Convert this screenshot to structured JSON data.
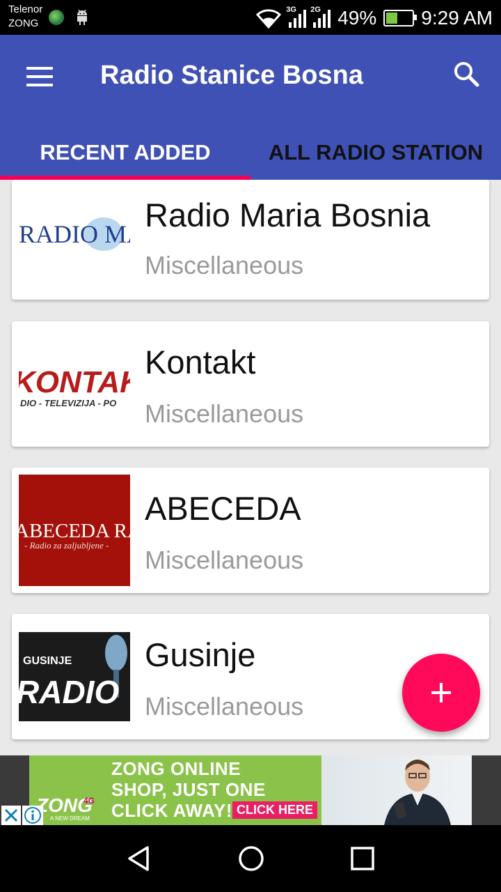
{
  "status_bar": {
    "carrier_1": "Telenor",
    "carrier_2": "ZONG",
    "network_1": "3G",
    "network_2": "2G",
    "battery_percent": "49%",
    "battery_level": 0.49,
    "time": "9:29 AM"
  },
  "app_bar": {
    "title": "Radio Stanice Bosna",
    "menu_icon": "hamburger-menu-icon",
    "search_icon": "search-icon",
    "color": "#3f51b5"
  },
  "tabs": [
    {
      "label": "RECENT ADDED",
      "active": true
    },
    {
      "label": "ALL RADIO STATION",
      "active": false
    }
  ],
  "accent_color": "#f50057",
  "stations": [
    {
      "name": "Radio Maria Bosnia",
      "category": "Miscellaneous",
      "logo_text": "RADIO MA"
    },
    {
      "name": "Kontakt",
      "category": "Miscellaneous",
      "logo_text": "KONTAK",
      "logo_subtext": "DIO - TELEVIZIJA - PO"
    },
    {
      "name": "ABECEDA",
      "category": "Miscellaneous",
      "logo_text": "ABECEDA RADIO",
      "logo_subtext": "- Radio za zaljubljene -"
    },
    {
      "name": "Gusinje",
      "category": "Miscellaneous",
      "logo_text": "RADIO",
      "logo_subtext": "GUSINJE"
    }
  ],
  "fab": {
    "icon": "plus-icon",
    "color": "#ff0a5a"
  },
  "ad": {
    "line_1": "ZONG ONLINE",
    "line_2": "SHOP, JUST ONE",
    "line_3": "CLICK AWAY!",
    "cta": "CLICK HERE",
    "brand": "ZONG",
    "brand_sub": "4G",
    "tagline": "A NEW DREAM",
    "close_icon": "close-icon",
    "info_icon": "info-icon"
  },
  "nav_bar": {
    "back_icon": "back-triangle-icon",
    "home_icon": "home-circle-icon",
    "recents_icon": "recents-square-icon"
  }
}
